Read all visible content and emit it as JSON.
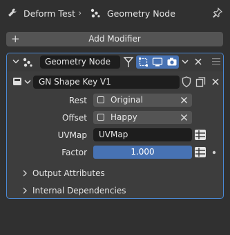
{
  "header": {
    "object_name": "Deform Test",
    "modifier_name": "Geometry Node"
  },
  "add_modifier": {
    "label": "Add Modifier"
  },
  "modifier": {
    "name": "Geometry Node",
    "node_group": "GN Shape Key V1",
    "inputs": [
      {
        "label": "Rest",
        "value": "Original"
      },
      {
        "label": "Offset",
        "value": "Happy"
      },
      {
        "label": "UVMap",
        "value": "UVMap"
      },
      {
        "label": "Factor",
        "value": "1.000"
      }
    ],
    "sections": [
      {
        "label": "Output Attributes"
      },
      {
        "label": "Internal Dependencies"
      }
    ]
  },
  "colors": {
    "background": "#303030",
    "panel": "#3d3d3d",
    "panel_border": "#4a8ad8",
    "accent_blue": "#4772b3",
    "field_dark": "#1d1d1d"
  },
  "icons": {
    "header": [
      "wrench-icon",
      "geometry-nodes-icon",
      "pin-icon"
    ],
    "modifier": [
      "collapse-chevron-icon",
      "geometry-nodes-icon",
      "on-cage-icon",
      "edit-mode-icon",
      "realtime-icon",
      "render-icon",
      "dropdown-icon",
      "remove-icon",
      "drag-handle-icon"
    ],
    "node_group": [
      "node-tree-icon",
      "fake-user-icon",
      "duplicate-icon",
      "unlink-icon"
    ]
  }
}
